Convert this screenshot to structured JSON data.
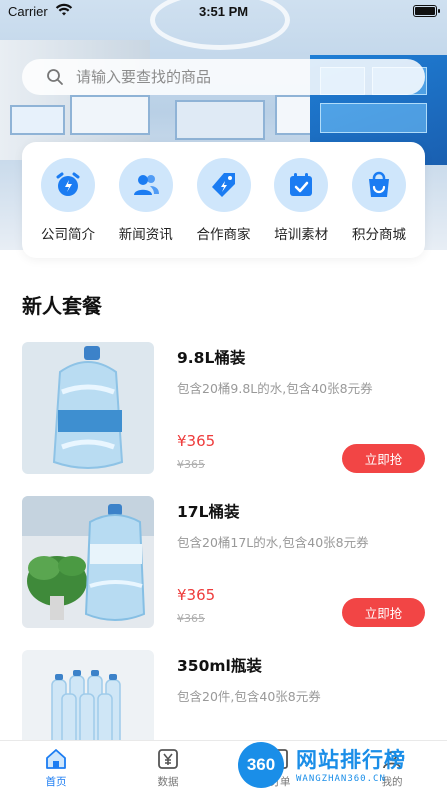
{
  "status_bar": {
    "carrier": "Carrier",
    "time": "3:51 PM"
  },
  "search": {
    "placeholder": "请输入要查找的商品"
  },
  "categories": [
    {
      "label": "公司简介",
      "icon": "alarm-clock-icon"
    },
    {
      "label": "新闻资讯",
      "icon": "people-icon"
    },
    {
      "label": "合作商家",
      "icon": "tag-lightning-icon"
    },
    {
      "label": "培训素材",
      "icon": "calendar-check-icon"
    },
    {
      "label": "积分商城",
      "icon": "shopping-bag-icon"
    }
  ],
  "section": {
    "title": "新人套餐"
  },
  "products": [
    {
      "name": "9.8L桶装",
      "desc": "包含20桶9.8L的水,包含40张8元券",
      "price": "¥365",
      "original_price": "¥365",
      "buy_label": "立即抢"
    },
    {
      "name": "17L桶装",
      "desc": "包含20桶17L的水,包含40张8元券",
      "price": "¥365",
      "original_price": "¥365",
      "buy_label": "立即抢"
    },
    {
      "name": "350ml瓶装",
      "desc": "包含20件,包含40张8元券"
    }
  ],
  "tabbar": {
    "items": [
      {
        "label": "首页",
        "icon": "home-icon",
        "active": true
      },
      {
        "label": "数据",
        "icon": "yen-data-icon",
        "active": false
      },
      {
        "label": "订单",
        "icon": "order-icon",
        "active": false
      },
      {
        "label": "我的",
        "icon": "profile-icon",
        "active": false
      }
    ]
  },
  "watermark": {
    "badge": "360",
    "title": "网站排行榜",
    "subtitle": "WANGZHAN360.CN"
  },
  "colors": {
    "accent": "#1b7cf2",
    "price": "#ee3b3b",
    "buy_button": "#f24545",
    "category_circle": "#cfe6fb"
  }
}
